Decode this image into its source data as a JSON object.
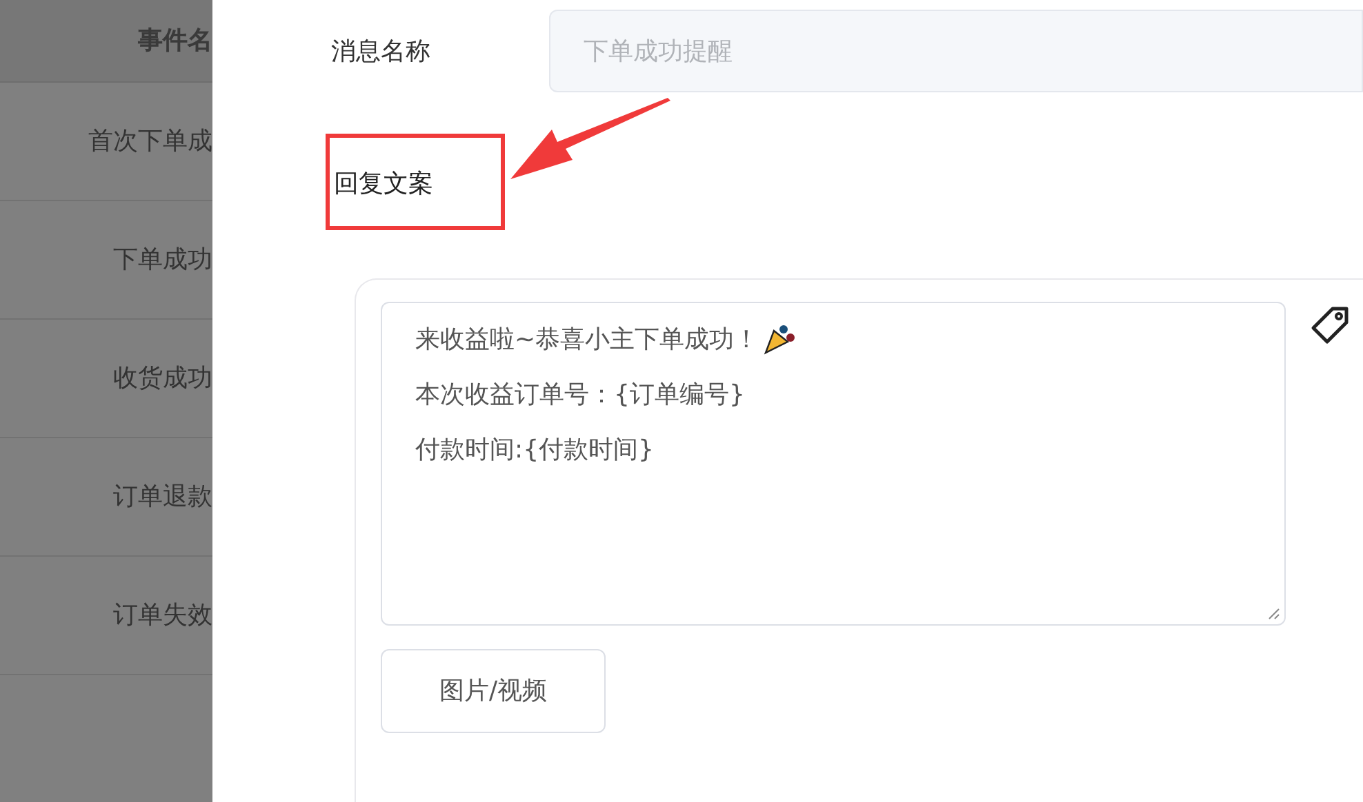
{
  "background_table": {
    "header": "事件名",
    "rows": [
      "首次下单成",
      "下单成功",
      "收货成功",
      "订单退款",
      "订单失效"
    ]
  },
  "drawer": {
    "message_name": {
      "label": "消息名称",
      "placeholder": "下单成功提醒"
    },
    "reply": {
      "label": "回复文案",
      "lines": [
        {
          "kind": "emoji",
          "text": "来收益啦~恭喜小主下单成功！"
        },
        {
          "kind": "variable",
          "text": "本次收益订单号：",
          "variable": "{订单编号}"
        },
        {
          "kind": "variable",
          "text": "付款时间:",
          "variable": "{付款时间}"
        }
      ],
      "media_button": "图片/视频"
    }
  }
}
